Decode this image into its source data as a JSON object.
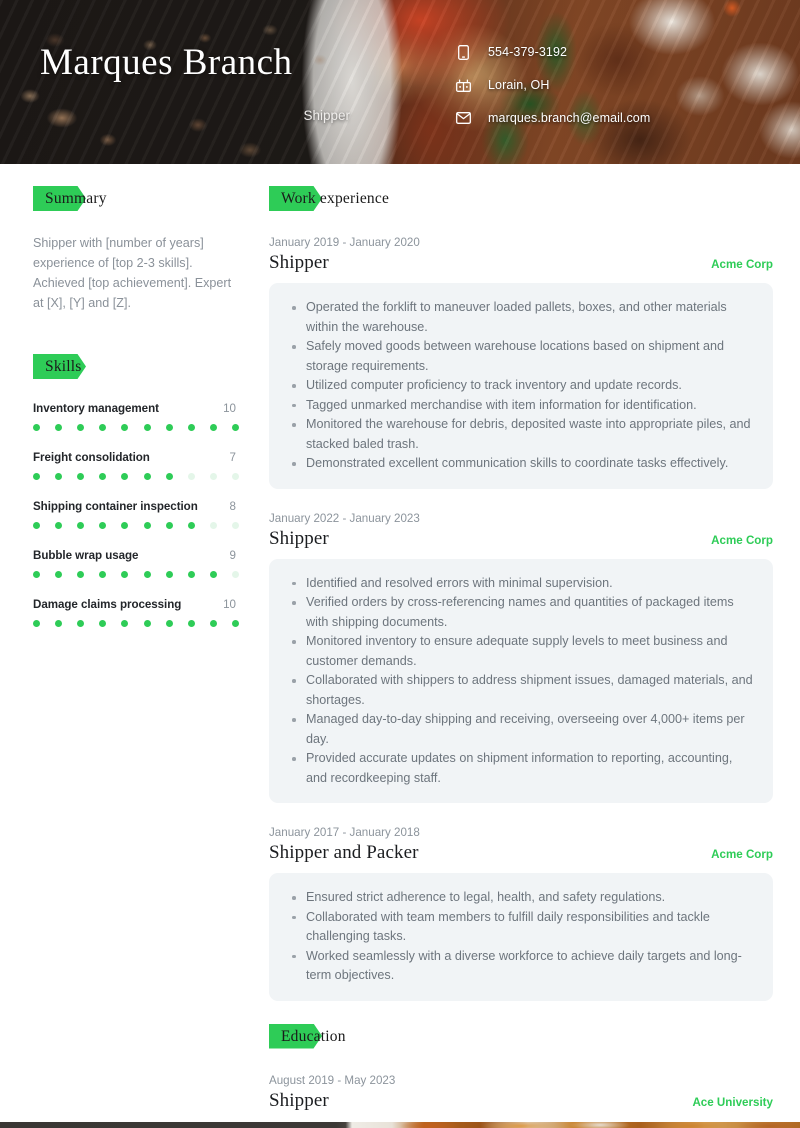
{
  "header": {
    "name": "Marques Branch",
    "role": "Shipper",
    "contacts": [
      {
        "icon": "phone-icon",
        "text": "554-379-3192"
      },
      {
        "icon": "location-icon",
        "text": "Lorain, OH"
      },
      {
        "icon": "email-icon",
        "text": "marques.branch@email.com"
      }
    ]
  },
  "sidebar": {
    "summary": {
      "title": "Summary",
      "text": "Shipper with [number of years] experience of [top 2-3 skills]. Achieved [top achievement]. Expert at [X], [Y] and [Z]."
    },
    "skills": {
      "title": "Skills",
      "max": 10,
      "items": [
        {
          "name": "Inventory management",
          "score": "10",
          "value": 10
        },
        {
          "name": "Freight consolidation",
          "score": "7",
          "value": 7
        },
        {
          "name": "Shipping container inspection",
          "score": "8",
          "value": 8
        },
        {
          "name": "Bubble wrap usage",
          "score": "9",
          "value": 9
        },
        {
          "name": "Damage claims processing",
          "score": "10",
          "value": 10
        }
      ]
    }
  },
  "main": {
    "work_experience": {
      "title": "Work experience",
      "entries": [
        {
          "date": "January 2019 - January 2020",
          "title": "Shipper",
          "org": "Acme Corp",
          "bullets": [
            "Operated the forklift to maneuver loaded pallets, boxes, and other materials within the warehouse.",
            "Safely moved goods between warehouse locations based on shipment and storage requirements.",
            "Utilized computer proficiency to track inventory and update records.",
            "Tagged unmarked merchandise with item information for identification.",
            "Monitored the warehouse for debris, deposited waste into appropriate piles, and stacked baled trash.",
            "Demonstrated excellent communication skills to coordinate tasks effectively."
          ]
        },
        {
          "date": "January 2022 - January 2023",
          "title": "Shipper",
          "org": "Acme Corp",
          "bullets": [
            "Identified and resolved errors with minimal supervision.",
            "Verified orders by cross-referencing names and quantities of packaged items with shipping documents.",
            "Monitored inventory to ensure adequate supply levels to meet business and customer demands.",
            "Collaborated with shippers to address shipment issues, damaged materials, and shortages.",
            "Managed day-to-day shipping and receiving, overseeing over 4,000+ items per day.",
            "Provided accurate updates on shipment information to reporting, accounting, and recordkeeping staff."
          ]
        },
        {
          "date": "January 2017 - January 2018",
          "title": "Shipper and Packer",
          "org": "Acme Corp",
          "bullets": [
            "Ensured strict adherence to legal, health, and safety regulations.",
            "Collaborated with team members to fulfill daily responsibilities and tackle challenging tasks.",
            "Worked seamlessly with a diverse workforce to achieve daily targets and long-term objectives."
          ]
        }
      ]
    },
    "education": {
      "title": "Education",
      "entries": [
        {
          "date": "August 2019 - May 2023",
          "title": "Shipper",
          "org": "Ace University",
          "bullets": []
        }
      ]
    }
  },
  "colors": {
    "accent_green": "#2ecc57",
    "card_background": "#f1f4f6",
    "muted_text": "#8c949c"
  }
}
